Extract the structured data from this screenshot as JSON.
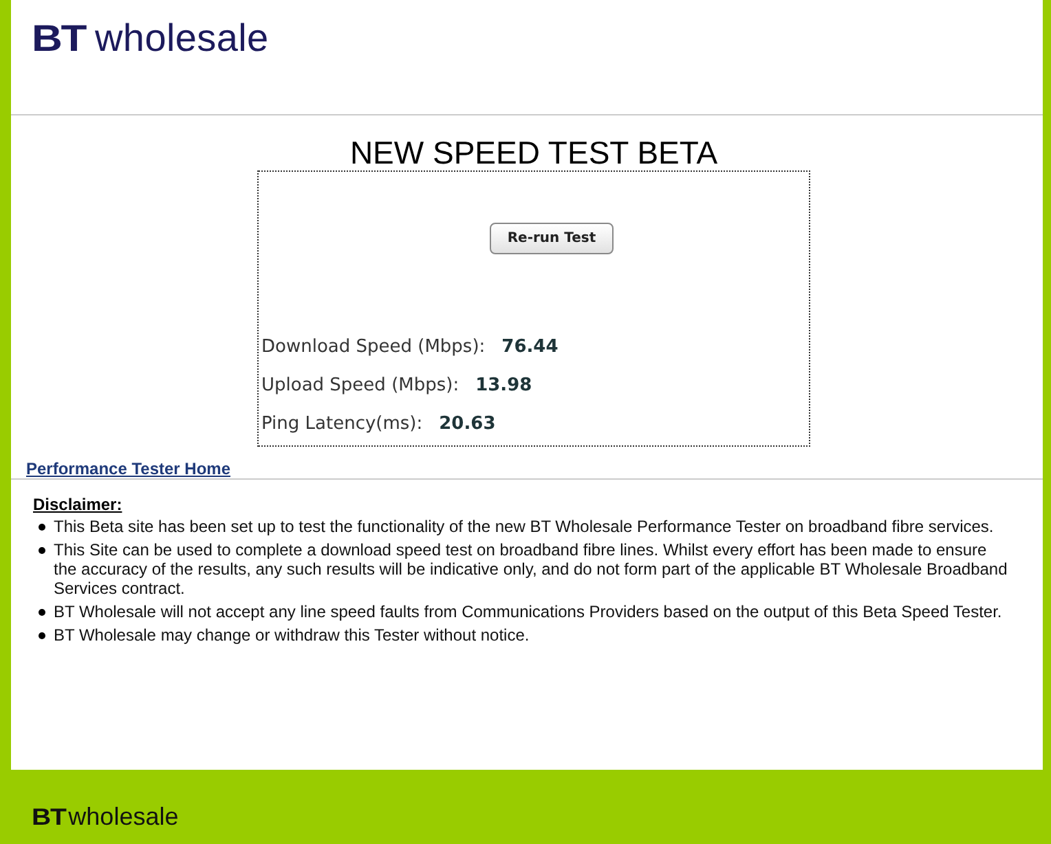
{
  "header": {
    "logo": {
      "mark": "BT",
      "name": "wholesale"
    }
  },
  "title": "NEW SPEED TEST BETA",
  "test_panel": {
    "button": "Re-run Test",
    "results": [
      {
        "label": "Download Speed (Mbps):",
        "value": "76.44"
      },
      {
        "label": "Upload Speed (Mbps):",
        "value": "13.98"
      },
      {
        "label": "Ping Latency(ms):",
        "value": "20.63"
      }
    ]
  },
  "home_link": "Performance Tester Home",
  "disclaimer": {
    "heading": "Disclaimer:",
    "items": [
      "This Beta site has been set up to test the functionality of the new BT Wholesale Performance Tester on broadband fibre services.",
      "This Site can be used to complete a download speed test on broadband fibre lines. Whilst every effort has been made to ensure the accuracy of the results, any such results will be indicative only, and do not form part of the applicable BT Wholesale Broadband Services contract.",
      "BT Wholesale will not accept any line speed faults from Communications Providers based on the output of this Beta Speed Tester.",
      "BT Wholesale may change or withdraw this Tester without notice."
    ]
  },
  "footer": {
    "logo": {
      "mark": "BT",
      "name": "wholesale"
    }
  }
}
